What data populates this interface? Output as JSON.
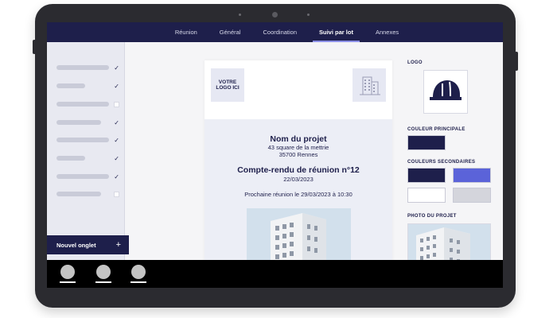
{
  "nav": {
    "tabs": [
      {
        "label": "Réunion",
        "active": false
      },
      {
        "label": "Général",
        "active": false
      },
      {
        "label": "Coordination",
        "active": false
      },
      {
        "label": "Suivi par lot",
        "active": true
      },
      {
        "label": "Annexes",
        "active": false
      }
    ]
  },
  "sidebar": {
    "items": [
      {
        "checked": true
      },
      {
        "checked": true
      },
      {
        "checked": false
      },
      {
        "checked": true
      },
      {
        "checked": true
      },
      {
        "checked": true
      },
      {
        "checked": true
      },
      {
        "checked": false
      }
    ],
    "new_tab_label": "Nouvel onglet",
    "new_tab_icon": "+"
  },
  "document": {
    "logo_placeholder": "VOTRE LOGO ICI",
    "project_name": "Nom du projet",
    "address_line1": "43 square de la mettrie",
    "address_line2": "35700 Rennes",
    "report_title": "Compte-rendu de réunion n°12",
    "report_date": "22/03/2023",
    "next_meeting": "Prochaine réunion le 29/03/2023 à 10:30"
  },
  "settings": {
    "logo_label": "LOGO",
    "logo_icon": "hard-hat-icon",
    "primary_color_label": "COULEUR PRINCIPALE",
    "primary_color": "#1e1f4b",
    "secondary_colors_label": "COULEURS SECONDAIRES",
    "secondary_colors": [
      "#1e1f4b",
      "#5b63d9",
      "#ffffff",
      "#d4d5dc"
    ],
    "project_photo_label": "PHOTO DU PROJET"
  },
  "taskbar": {
    "items": 3
  }
}
